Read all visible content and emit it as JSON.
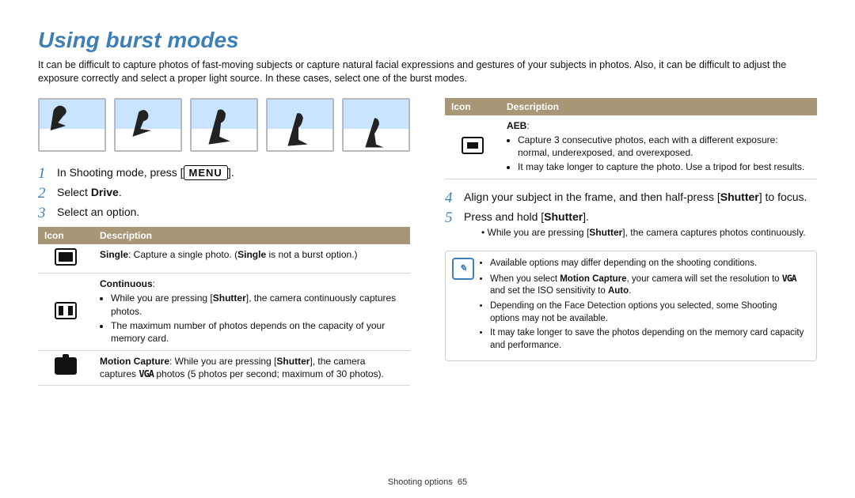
{
  "title": "Using burst modes",
  "intro": "It can be difficult to capture photos of fast-moving subjects or capture natural facial expressions and gestures of your subjects in photos. Also, it can be difficult to adjust the exposure correctly and select a proper light source. In these cases, select one of the burst modes.",
  "left": {
    "step1_pre": "In Shooting mode, press [",
    "step1_btn": "MENU",
    "step1_post": "].",
    "step2_pre": "Select ",
    "step2_bold": "Drive",
    "step2_post": ".",
    "step3": "Select an option.",
    "table": {
      "h_icon": "Icon",
      "h_desc": "Description",
      "rows": [
        {
          "icon": "single",
          "title": "Single",
          "body": ": Capture a single photo. (",
          "bold2": "Single",
          "body2": " is not a burst option.)"
        },
        {
          "icon": "cont",
          "title": "Continuous",
          "body": ":",
          "bullets": [
            {
              "pre": "While you are pressing [",
              "b": "Shutter",
              "post": "], the camera continuously captures photos."
            },
            {
              "pre": "The maximum number of photos depends on the capacity of your memory card.",
              "b": "",
              "post": ""
            }
          ]
        },
        {
          "icon": "motion",
          "title": "Motion Capture",
          "body_pre": ": While you are pressing [",
          "body_b": "Shutter",
          "body_mid": "], the camera captures ",
          "vga": "VGA",
          "body_post": " photos (5 photos per second; maximum of 30 photos)."
        }
      ]
    }
  },
  "right": {
    "table": {
      "h_icon": "Icon",
      "h_desc": "Description",
      "row": {
        "icon": "aeb",
        "title": "AEB",
        "body": ":",
        "bullets": [
          "Capture 3 consecutive photos, each with a different exposure: normal, underexposed, and overexposed.",
          "It may take longer to capture the photo. Use a tripod for best results."
        ]
      }
    },
    "step4_pre": "Align your subject in the frame, and then half-press [",
    "step4_b": "Shutter",
    "step4_post": "] to focus.",
    "step5_pre": "Press and hold [",
    "step5_b": "Shutter",
    "step5_post": "].",
    "step5_sub_pre": "While you are pressing [",
    "step5_sub_b": "Shutter",
    "step5_sub_post": "], the camera captures photos continuously.",
    "info": {
      "items": [
        {
          "t": "Available options may differ depending on the shooting conditions."
        },
        {
          "pre": "When you select ",
          "b": "Motion Capture",
          "mid": ", your camera will set the resolution to ",
          "vga": "VGA",
          "post2": " and set the ISO sensitivity to ",
          "b2": "Auto",
          "post3": "."
        },
        {
          "t": "Depending on the Face Detection options you selected, some Shooting options may not be available."
        },
        {
          "t": "It may take longer to save the photos depending on the memory card capacity and performance."
        }
      ]
    }
  },
  "footer_label": "Shooting options",
  "footer_page": "65"
}
